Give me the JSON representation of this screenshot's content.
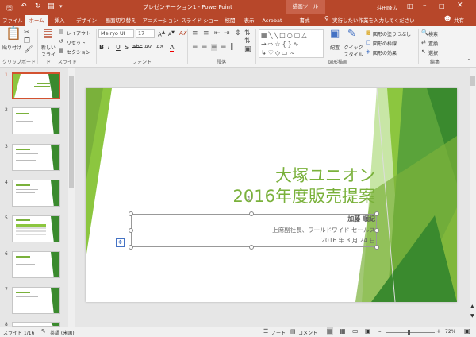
{
  "titlebar": {
    "title": "プレゼンテーション1 - PowerPoint",
    "context_tab": "描画ツール",
    "user": "荘田隆広"
  },
  "tabs": [
    "ファイル",
    "ホーム",
    "挿入",
    "デザイン",
    "画面切り替え",
    "アニメーション",
    "スライド ショー",
    "校閲",
    "表示",
    "Acrobat",
    "書式"
  ],
  "tell_me": "実行したい作業を入力してください",
  "share": "共有",
  "ribbon": {
    "clipboard": {
      "paste": "貼り付け",
      "label": "クリップボード"
    },
    "slides": {
      "new_slide": "新しい スライド",
      "layout": "レイアウト",
      "reset": "リセット",
      "section": "セクション",
      "label": "スライド"
    },
    "font": {
      "name": "Meiryo UI",
      "size": "17",
      "label": "フォント"
    },
    "paragraph": {
      "label": "段落"
    },
    "drawing": {
      "arrange": "配置",
      "quick_style": "クイック スタイル",
      "fill": "図形の塗りつぶし",
      "outline": "図形の枠線",
      "effects": "図形の効果",
      "label": "図形描画"
    },
    "editing": {
      "find": "検索",
      "replace": "置換",
      "select": "選択",
      "label": "編集"
    }
  },
  "thumbnails": [
    "1",
    "2",
    "3",
    "4",
    "5",
    "6",
    "7",
    "8"
  ],
  "slide": {
    "title1": "大塚ユニオン",
    "title2": "2016年度販売提案",
    "presenter": "加藤 順紀",
    "role": "上席副社長、ワールドワイド セールス",
    "date": "2016 年 3 月 24 日"
  },
  "status": {
    "slide": "スライド 1/16",
    "lang": "英語 (米国)",
    "notes": "ノート",
    "comments": "コメント",
    "zoom": "72%"
  },
  "colors": {
    "accent": "#b7472a",
    "green": "#8cc63f",
    "dark_green": "#3a8a2e",
    "title_green": "#7ab13b"
  }
}
